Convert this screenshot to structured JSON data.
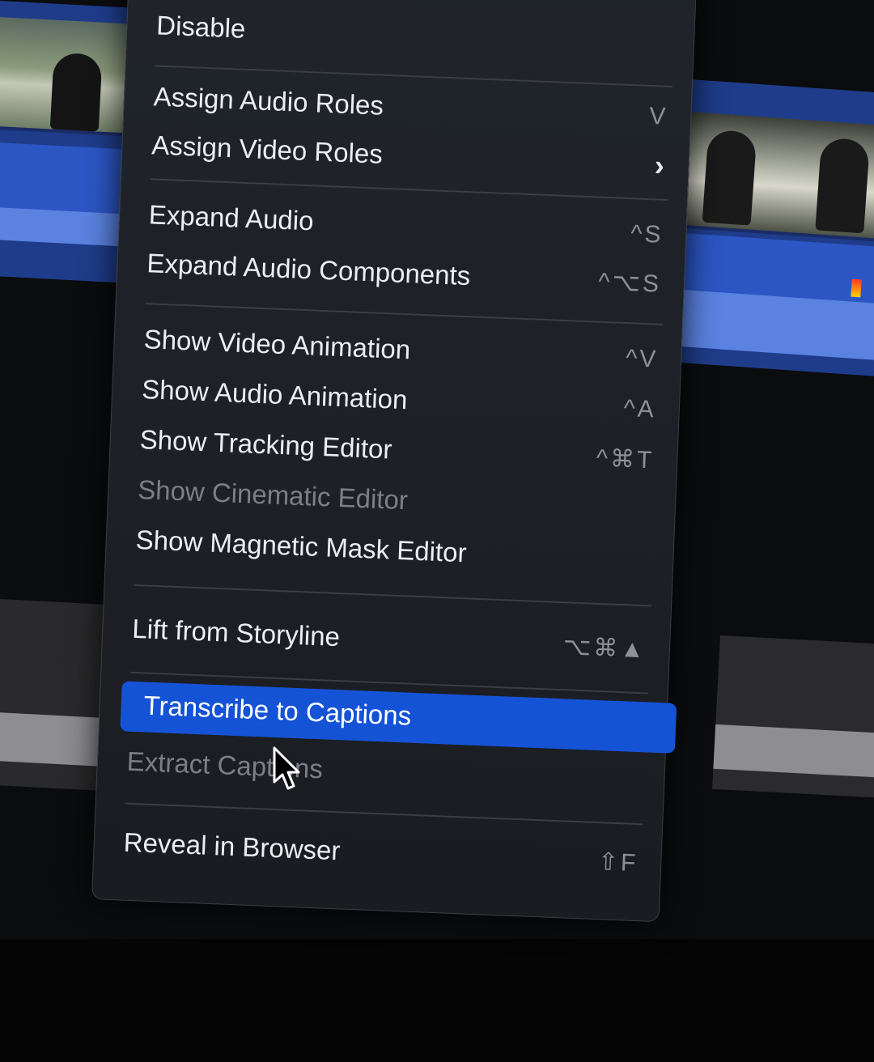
{
  "menu": {
    "items": [
      {
        "label": "Disable",
        "shortcut": "",
        "disabled": false
      },
      {
        "label": "Assign Audio Roles",
        "shortcut": "V",
        "disabled": false
      },
      {
        "label": "Assign Video Roles",
        "shortcut": "",
        "submenu": true,
        "disabled": false
      },
      {
        "label": "Expand Audio",
        "shortcut": "^S",
        "disabled": true
      },
      {
        "label": "Expand Audio Components",
        "shortcut": "^⌥S",
        "disabled": false
      },
      {
        "label": "Show Video Animation",
        "shortcut": "^V",
        "disabled": false
      },
      {
        "label": "Show Audio Animation",
        "shortcut": "^A",
        "disabled": false
      },
      {
        "label": "Show Tracking Editor",
        "shortcut": "^⌘T",
        "disabled": false
      },
      {
        "label": "Show Cinematic Editor",
        "shortcut": "",
        "disabled": true
      },
      {
        "label": "Show Magnetic Mask Editor",
        "shortcut": "",
        "disabled": false
      },
      {
        "label": "Lift from Storyline",
        "shortcut": "⌥⌘▲",
        "disabled": false
      },
      {
        "label": "Transcribe to Captions",
        "shortcut": "",
        "highlighted": true,
        "disabled": false
      },
      {
        "label": "Extract Captions",
        "shortcut": "",
        "disabled": true
      },
      {
        "label": "Reveal in Browser",
        "shortcut": "⇧F",
        "disabled": false
      }
    ],
    "submenu_glyph": "›"
  },
  "icons": {
    "cursor": "arrow-cursor-icon",
    "submenu": "chevron-right-icon"
  },
  "colors": {
    "menu_bg": "#1e2127",
    "highlight": "#1553d6",
    "clip_blue": "#1f3c8a",
    "wave_blue": "#5b82e0"
  }
}
